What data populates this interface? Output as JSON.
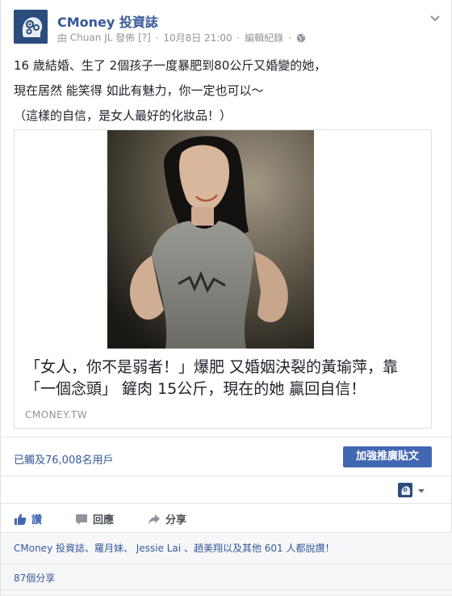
{
  "post": {
    "page_name": "CMoney 投資誌",
    "by_label": "由",
    "author": "Chuan JL",
    "published_label": "發佈",
    "help_mark": "[?]",
    "timestamp": "10月8日 21:00",
    "edit_history": "編輯紀錄",
    "sep": "·",
    "text_lines": [
      "16 歲結婚、生了 2個孩子一度暴肥到80公斤又婚變的她，",
      "現在居然 能笑得 如此有魅力，你一定也可以～",
      "（這樣的自信，是女人最好的化妝品！）"
    ]
  },
  "link_preview": {
    "title": "「女人，你不是弱者！」爆肥 又婚姻決裂的黃瑜萍，靠「一個念頭」 鏟肉 15公斤，現在的她 贏回自信！",
    "domain": "CMONEY.TW"
  },
  "insights": {
    "reach": "已觸及76,008名用戶",
    "boost_label": "加強推廣貼文"
  },
  "actions": {
    "like": "讚",
    "comment": "回應",
    "share": "分享"
  },
  "feedback": {
    "likers": "CMoney 投資誌、羅月妹、 Jessie Lai 、趙美翔以及其他 601 人都說讚！",
    "shares": "87個分享"
  },
  "colors": {
    "brand_blue": "#4267b2",
    "link_blue": "#365899",
    "meta_gray": "#90949c"
  },
  "icons": {
    "avatar": "gear-head-icon",
    "privacy": "globe-icon",
    "menu": "chevron-down-icon",
    "like": "thumbs-up-icon",
    "comment": "speech-bubble-icon",
    "share": "share-arrow-icon"
  }
}
